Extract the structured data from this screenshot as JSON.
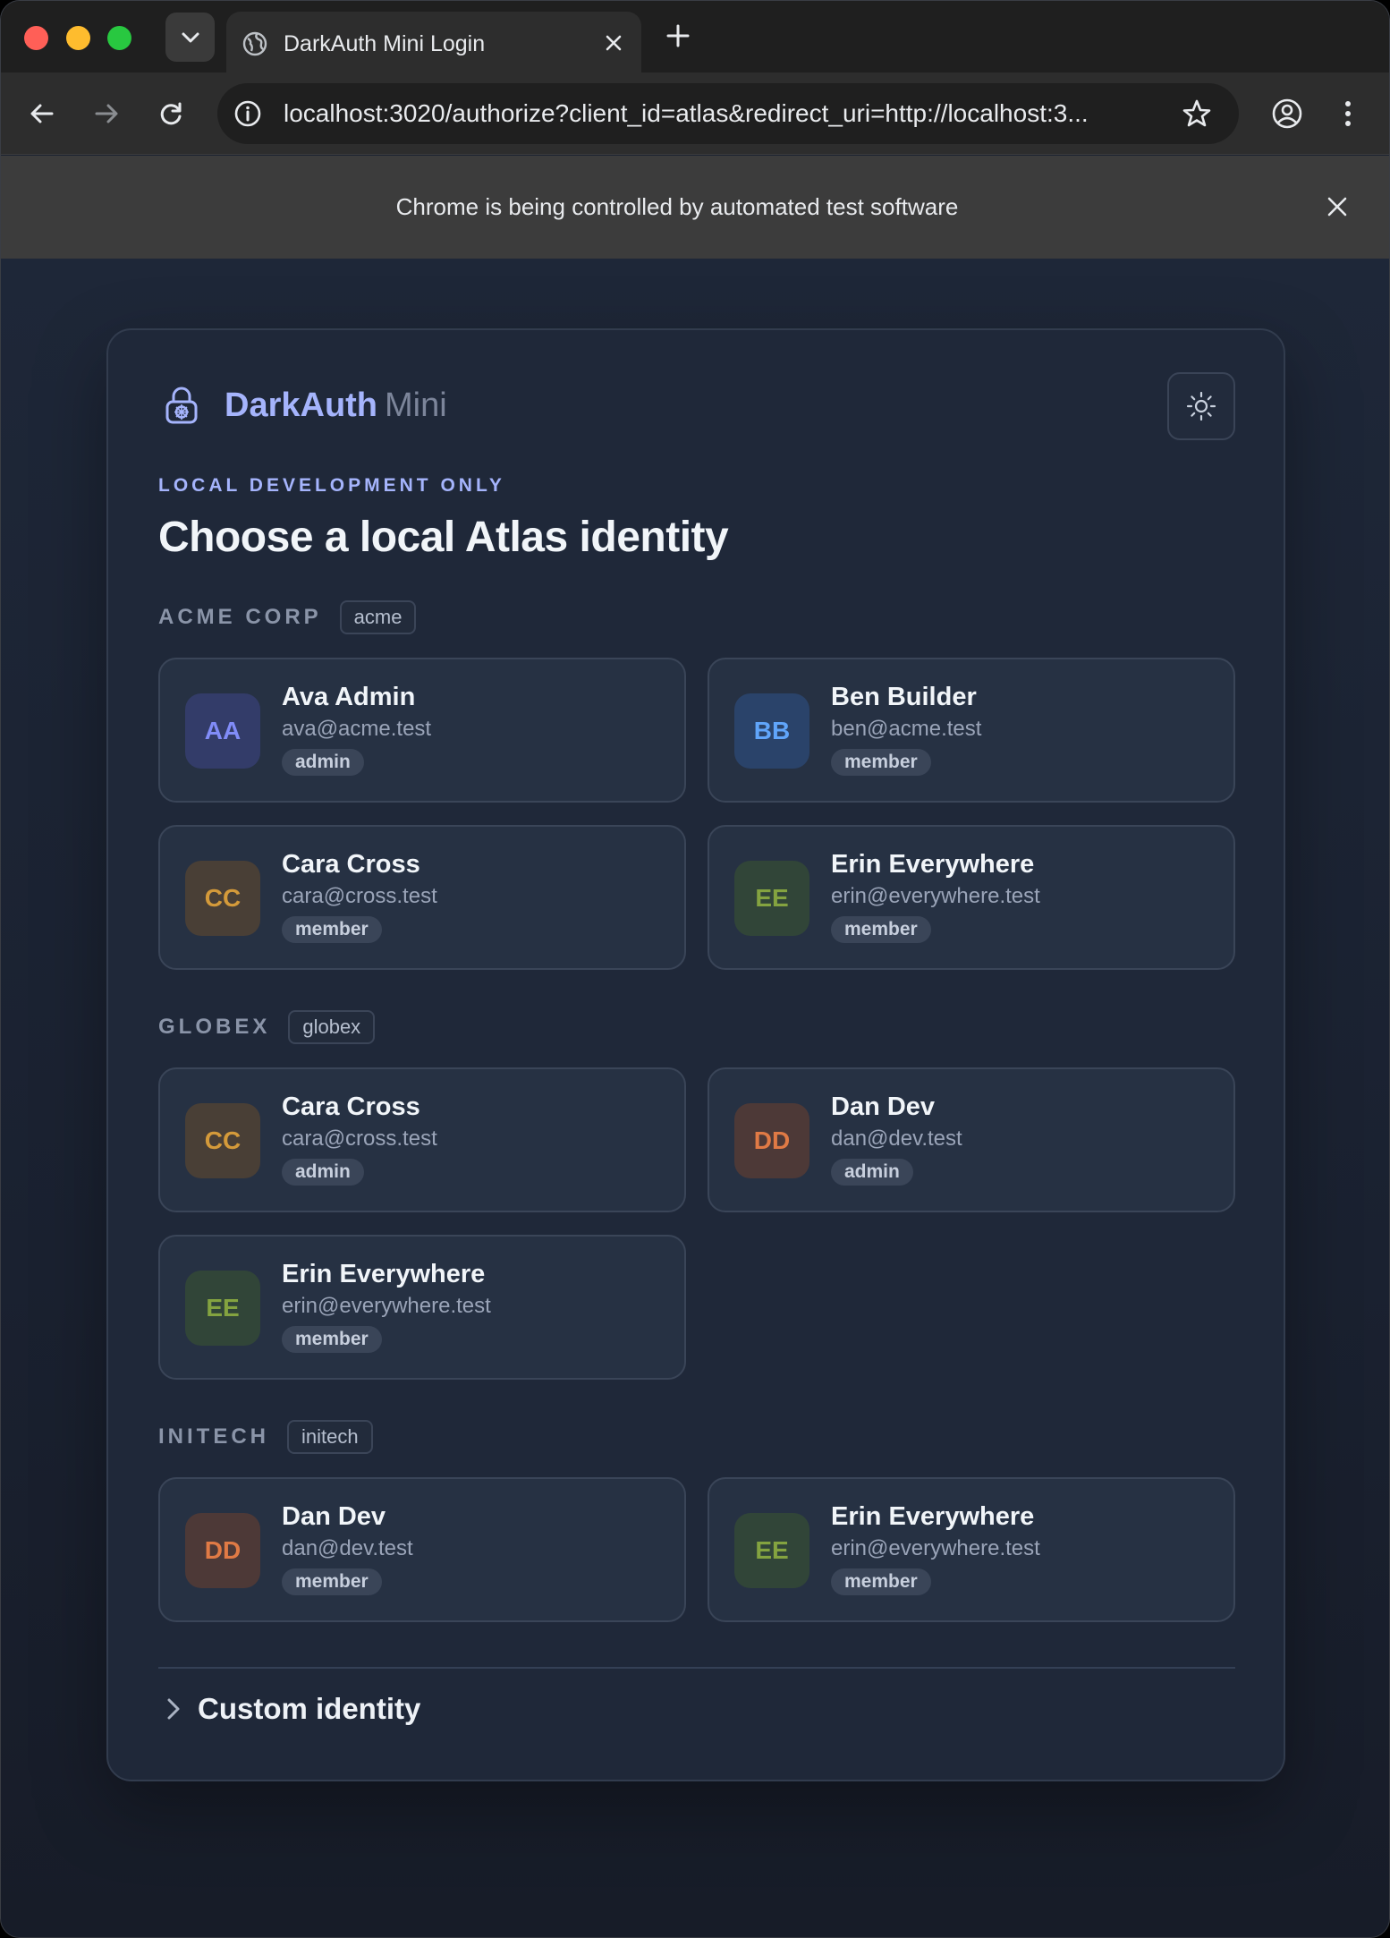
{
  "browser": {
    "tab_title": "DarkAuth Mini Login",
    "url": "localhost:3020/authorize?client_id=atlas&redirect_uri=http://localhost:3...",
    "infobar_text": "Chrome is being controlled by automated test software"
  },
  "brand": {
    "name": "DarkAuth",
    "suffix": "Mini"
  },
  "eyebrow": "LOCAL DEVELOPMENT ONLY",
  "headline": "Choose a local Atlas identity",
  "groups": [
    {
      "name": "ACME CORP",
      "slug": "acme",
      "identities": [
        {
          "initials": "AA",
          "name": "Ava Admin",
          "email": "ava@acme.test",
          "role": "admin",
          "color": "#6366f1"
        },
        {
          "initials": "BB",
          "name": "Ben Builder",
          "email": "ben@acme.test",
          "role": "member",
          "color": "#3b82f6"
        },
        {
          "initials": "CC",
          "name": "Cara Cross",
          "email": "cara@cross.test",
          "role": "member",
          "color": "#d97706"
        },
        {
          "initials": "EE",
          "name": "Erin Everywhere",
          "email": "erin@everywhere.test",
          "role": "member",
          "color": "#65a30d"
        }
      ]
    },
    {
      "name": "GLOBEX",
      "slug": "globex",
      "identities": [
        {
          "initials": "CC",
          "name": "Cara Cross",
          "email": "cara@cross.test",
          "role": "admin",
          "color": "#d97706"
        },
        {
          "initials": "DD",
          "name": "Dan Dev",
          "email": "dan@dev.test",
          "role": "admin",
          "color": "#ea580c"
        },
        {
          "initials": "EE",
          "name": "Erin Everywhere",
          "email": "erin@everywhere.test",
          "role": "member",
          "color": "#65a30d"
        }
      ]
    },
    {
      "name": "INITECH",
      "slug": "initech",
      "identities": [
        {
          "initials": "DD",
          "name": "Dan Dev",
          "email": "dan@dev.test",
          "role": "member",
          "color": "#ea580c"
        },
        {
          "initials": "EE",
          "name": "Erin Everywhere",
          "email": "erin@everywhere.test",
          "role": "member",
          "color": "#65a30d"
        }
      ]
    }
  ],
  "custom_identity_label": "Custom identity"
}
